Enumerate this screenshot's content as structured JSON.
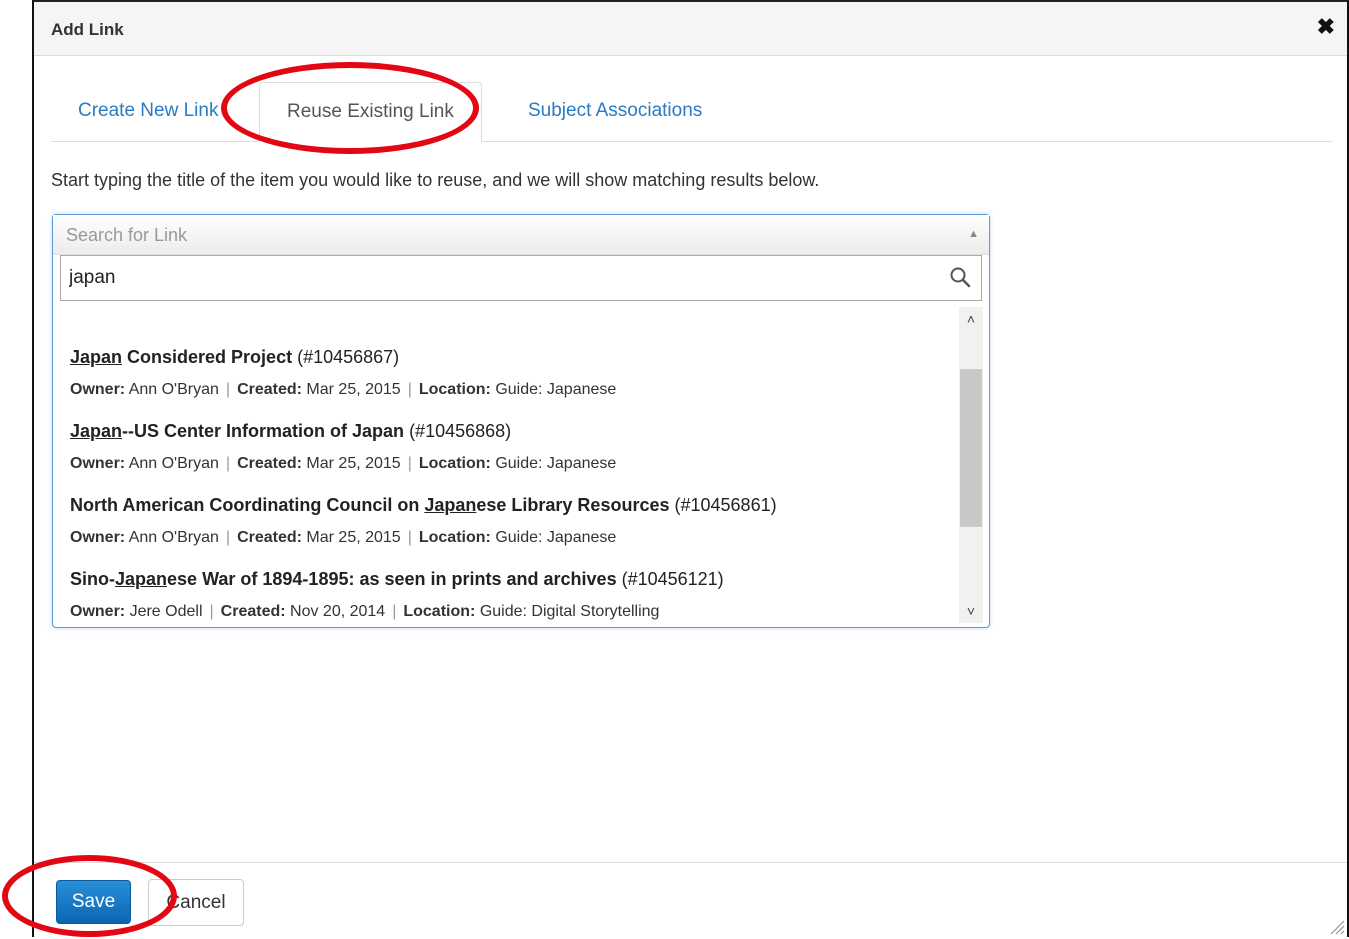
{
  "dialog": {
    "title": "Add Link",
    "close_icon": "close-icon"
  },
  "tabs": [
    {
      "label": "Create New Link",
      "active": false
    },
    {
      "label": "Reuse Existing Link",
      "active": true
    },
    {
      "label": "Subject Associations",
      "active": false
    }
  ],
  "instructions": "Start typing the title of the item you would like to reuse, and we will show matching results below.",
  "search": {
    "header_placeholder": "Search for Link",
    "value": "japan",
    "icon": "magnifier-icon"
  },
  "results": [
    {
      "title_underlined": "Japan",
      "title_rest": " Considered Project",
      "title_prefix": "",
      "id": "(#10456867)",
      "owner_label": "Owner:",
      "owner": "Ann O'Bryan",
      "created_label": "Created:",
      "created": "Mar 25, 2015",
      "location_label": "Location:",
      "location": "Guide: Japanese"
    },
    {
      "title_underlined": "Japan",
      "title_rest": "--US Center Information of Japan",
      "title_prefix": "",
      "id": "(#10456868)",
      "owner_label": "Owner:",
      "owner": "Ann O'Bryan",
      "created_label": "Created:",
      "created": "Mar 25, 2015",
      "location_label": "Location:",
      "location": "Guide: Japanese"
    },
    {
      "title_prefix": "North American Coordinating Council on ",
      "title_underlined": "Japan",
      "title_rest": "ese Library Resources",
      "id": "(#10456861)",
      "owner_label": "Owner:",
      "owner": "Ann O'Bryan",
      "created_label": "Created:",
      "created": "Mar 25, 2015",
      "location_label": "Location:",
      "location": "Guide: Japanese"
    },
    {
      "title_prefix": "Sino-",
      "title_underlined": "Japan",
      "title_rest": "ese War of 1894-1895: as seen in prints and archives",
      "id": "(#10456121)",
      "owner_label": "Owner:",
      "owner": "Jere Odell",
      "created_label": "Created:",
      "created": "Nov 20, 2014",
      "location_label": "Location:",
      "location": "Guide: Digital Storytelling"
    }
  ],
  "footer": {
    "save_label": "Save",
    "cancel_label": "Cancel"
  },
  "colors": {
    "accent": "#2a7bc4",
    "save_button": "#1a7cc8",
    "highlight": "#e30613"
  }
}
